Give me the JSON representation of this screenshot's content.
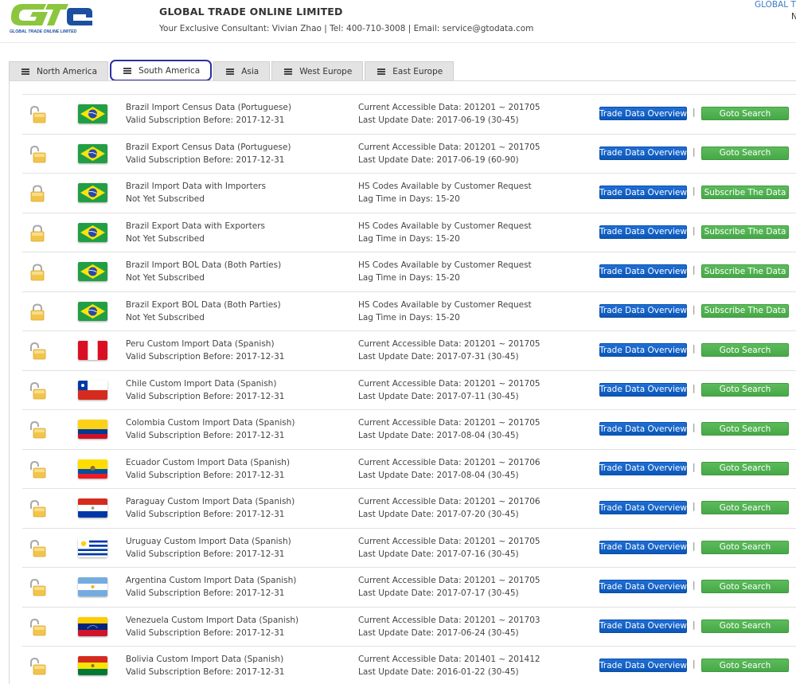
{
  "header": {
    "logo_text": "GLOBAL TRADE ONLINE LIMITED",
    "company_name": "GLOBAL TRADE ONLINE LIMITED",
    "contact": "Your Exclusive Consultant: Vivian Zhao | Tel: 400-710-3008 | Email: service@gtodata.com",
    "top_right_line1": "GLOBAL TR",
    "top_right_line2": "N"
  },
  "tabs": [
    {
      "label": "North America",
      "active": false
    },
    {
      "label": "South America",
      "active": true
    },
    {
      "label": "Asia",
      "active": false
    },
    {
      "label": "West Europe",
      "active": false
    },
    {
      "label": "East Europe",
      "active": false
    }
  ],
  "colors": {
    "overview_button": "#0c57b8",
    "action_button": "#4cae4c",
    "active_tab_outline": "#2b2fa3",
    "top_right_text": "#3b7cc4"
  },
  "rows": [
    {
      "country": "brazil",
      "lock": "unlocked",
      "title": "Brazil Import Census Data (Portuguese)",
      "sub": "Valid Subscription Before: 2017-12-31",
      "info1": "Current Accessible Data: 201201 ~ 201705",
      "info2": "Last Update Date: 2017-06-19 (30-45)",
      "overview": "Trade Data Overview",
      "sep": "|",
      "action": "Goto Search"
    },
    {
      "country": "brazil",
      "lock": "unlocked",
      "title": "Brazil Export Census Data (Portuguese)",
      "sub": "Valid Subscription Before: 2017-12-31",
      "info1": "Current Accessible Data: 201201 ~ 201705",
      "info2": "Last Update Date: 2017-06-19 (60-90)",
      "overview": "Trade Data Overview",
      "sep": "|",
      "action": "Goto Search"
    },
    {
      "country": "brazil",
      "lock": "locked",
      "title": "Brazil Import Data with Importers",
      "sub": "Not Yet Subscribed",
      "info1": "HS Codes Available by Customer Request",
      "info2": "Lag Time in Days: 15-20",
      "overview": "Trade Data Overview",
      "sep": "|",
      "action": "Subscribe The Data"
    },
    {
      "country": "brazil",
      "lock": "locked",
      "title": "Brazil Export Data with Exporters",
      "sub": "Not Yet Subscribed",
      "info1": "HS Codes Available by Customer Request",
      "info2": "Lag Time in Days: 15-20",
      "overview": "Trade Data Overview",
      "sep": "|",
      "action": "Subscribe The Data"
    },
    {
      "country": "brazil",
      "lock": "locked",
      "title": "Brazil Import BOL Data (Both Parties)",
      "sub": "Not Yet Subscribed",
      "info1": "HS Codes Available by Customer Request",
      "info2": "Lag Time in Days: 15-20",
      "overview": "Trade Data Overview",
      "sep": "|",
      "action": "Subscribe The Data"
    },
    {
      "country": "brazil",
      "lock": "locked",
      "title": "Brazil Export BOL Data (Both Parties)",
      "sub": "Not Yet Subscribed",
      "info1": "HS Codes Available by Customer Request",
      "info2": "Lag Time in Days: 15-20",
      "overview": "Trade Data Overview",
      "sep": "|",
      "action": "Subscribe The Data"
    },
    {
      "country": "peru",
      "lock": "unlocked",
      "title": "Peru Custom Import Data (Spanish)",
      "sub": "Valid Subscription Before: 2017-12-31",
      "info1": "Current Accessible Data: 201201 ~ 201705",
      "info2": "Last Update Date: 2017-07-31 (30-45)",
      "overview": "Trade Data Overview",
      "sep": "|",
      "action": "Goto Search"
    },
    {
      "country": "chile",
      "lock": "unlocked",
      "title": "Chile Custom Import Data (Spanish)",
      "sub": "Valid Subscription Before: 2017-12-31",
      "info1": "Current Accessible Data: 201201 ~ 201705",
      "info2": "Last Update Date: 2017-07-11 (30-45)",
      "overview": "Trade Data Overview",
      "sep": "|",
      "action": "Goto Search"
    },
    {
      "country": "colombia",
      "lock": "unlocked",
      "title": "Colombia Custom Import Data (Spanish)",
      "sub": "Valid Subscription Before: 2017-12-31",
      "info1": "Current Accessible Data: 201201 ~ 201705",
      "info2": "Last Update Date: 2017-08-04 (30-45)",
      "overview": "Trade Data Overview",
      "sep": "|",
      "action": "Goto Search"
    },
    {
      "country": "ecuador",
      "lock": "unlocked",
      "title": "Ecuador Custom Import Data (Spanish)",
      "sub": "Valid Subscription Before: 2017-12-31",
      "info1": "Current Accessible Data: 201201 ~ 201706",
      "info2": "Last Update Date: 2017-08-04 (30-45)",
      "overview": "Trade Data Overview",
      "sep": "|",
      "action": "Goto Search"
    },
    {
      "country": "paraguay",
      "lock": "unlocked",
      "title": "Paraguay Custom Import Data (Spanish)",
      "sub": "Valid Subscription Before: 2017-12-31",
      "info1": "Current Accessible Data: 201201 ~ 201706",
      "info2": "Last Update Date: 2017-07-20 (30-45)",
      "overview": "Trade Data Overview",
      "sep": "|",
      "action": "Goto Search"
    },
    {
      "country": "uruguay",
      "lock": "unlocked",
      "title": "Uruguay Custom Import Data (Spanish)",
      "sub": "Valid Subscription Before: 2017-12-31",
      "info1": "Current Accessible Data: 201201 ~ 201705",
      "info2": "Last Update Date: 2017-07-16 (30-45)",
      "overview": "Trade Data Overview",
      "sep": "|",
      "action": "Goto Search"
    },
    {
      "country": "argentina",
      "lock": "unlocked",
      "title": "Argentina Custom Import Data (Spanish)",
      "sub": "Valid Subscription Before: 2017-12-31",
      "info1": "Current Accessible Data: 201201 ~ 201705",
      "info2": "Last Update Date: 2017-07-17 (30-45)",
      "overview": "Trade Data Overview",
      "sep": "|",
      "action": "Goto Search"
    },
    {
      "country": "venezuela",
      "lock": "unlocked",
      "title": "Venezuela Custom Import Data (Spanish)",
      "sub": "Valid Subscription Before: 2017-12-31",
      "info1": "Current Accessible Data: 201201 ~ 201703",
      "info2": "Last Update Date: 2017-06-24 (30-45)",
      "overview": "Trade Data Overview",
      "sep": "|",
      "action": "Goto Search"
    },
    {
      "country": "bolivia",
      "lock": "unlocked",
      "title": "Bolivia Custom Import Data (Spanish)",
      "sub": "Valid Subscription Before: 2017-12-31",
      "info1": "Current Accessible Data: 201401 ~ 201412",
      "info2": "Last Update Date: 2016-01-22 (30-45)",
      "overview": "Trade Data Overview",
      "sep": "|",
      "action": "Goto Search"
    }
  ]
}
